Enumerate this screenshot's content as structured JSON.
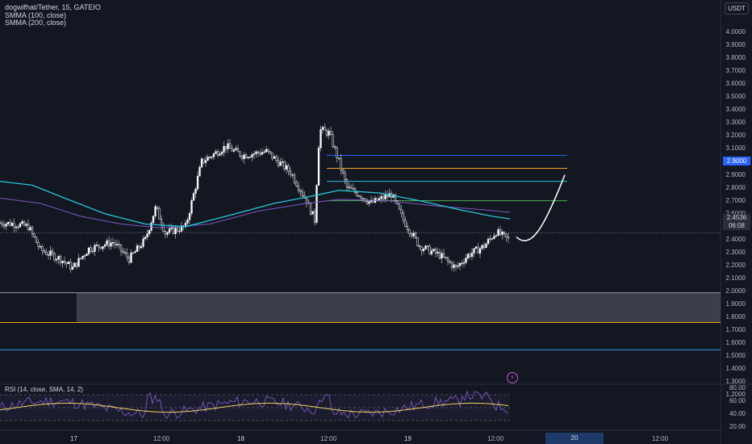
{
  "legend": {
    "symbol": "dogwifhat/Tether, 15, GATEIO",
    "smma100": "SMMA (100, close)",
    "smma200": "SMMA (200, close)"
  },
  "currency": "USDT",
  "price_axis": [
    "4.0000",
    "3.9000",
    "3.8000",
    "3.7000",
    "3.6000",
    "3.5000",
    "3.4000",
    "3.3000",
    "3.2000",
    "3.1000",
    "3.0000",
    "2.9000",
    "2.8000",
    "2.7000",
    "2.6000",
    "2.5000",
    "2.4000",
    "2.3000",
    "2.2000",
    "2.1000",
    "2.0000",
    "1.9000",
    "1.8000",
    "1.7000",
    "1.6000",
    "1.5000",
    "1.4000",
    "1.3000",
    "1.2000"
  ],
  "highlighted_price": "2.9000",
  "last_price": {
    "value": "2.4536",
    "countdown": "06:08"
  },
  "rsi": {
    "label": "RSI (14, close, SMA, 14, 2)",
    "axis": [
      "80.00",
      "60.00",
      "40.00",
      "20.00"
    ]
  },
  "time_axis": {
    "labels": [
      "17",
      "12:00",
      "18",
      "12:00",
      "19",
      "12:00",
      "12:00"
    ],
    "highlighted": "20"
  },
  "colors": {
    "background": "#131722",
    "smma100": "#26c6da",
    "smma200": "#7e57c2",
    "fib_blue": "#2962ff",
    "fib_orange": "#f5a623",
    "fib_green": "#4caf50",
    "zone_fill": "#5d6069",
    "rsi_line": "#7e57c2",
    "rsi_ma": "#f0d45a"
  },
  "icons": [
    "lightning-icon"
  ]
}
